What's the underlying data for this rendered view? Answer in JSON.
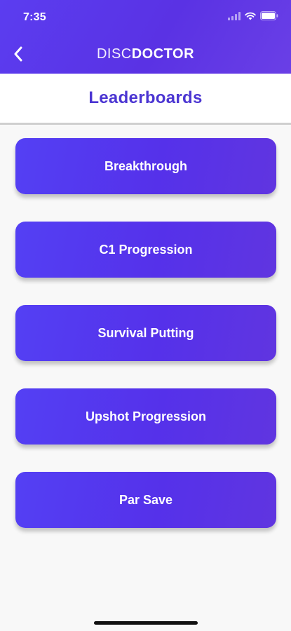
{
  "status_bar": {
    "time": "7:35",
    "icons": [
      "signal-icon",
      "wifi-icon",
      "battery-icon"
    ]
  },
  "nav": {
    "back_icon": "chevron-left-icon",
    "title_light": "DISC",
    "title_bold": "DOCTOR"
  },
  "page": {
    "title": "Leaderboards"
  },
  "leaderboards": [
    {
      "label": "Breakthrough"
    },
    {
      "label": "C1 Progression"
    },
    {
      "label": "Survival Putting"
    },
    {
      "label": "Upshot Progression"
    },
    {
      "label": "Par Save"
    }
  ],
  "colors": {
    "accent": "#5531ea",
    "title": "#4b35d2",
    "background": "#f8f8f8"
  }
}
